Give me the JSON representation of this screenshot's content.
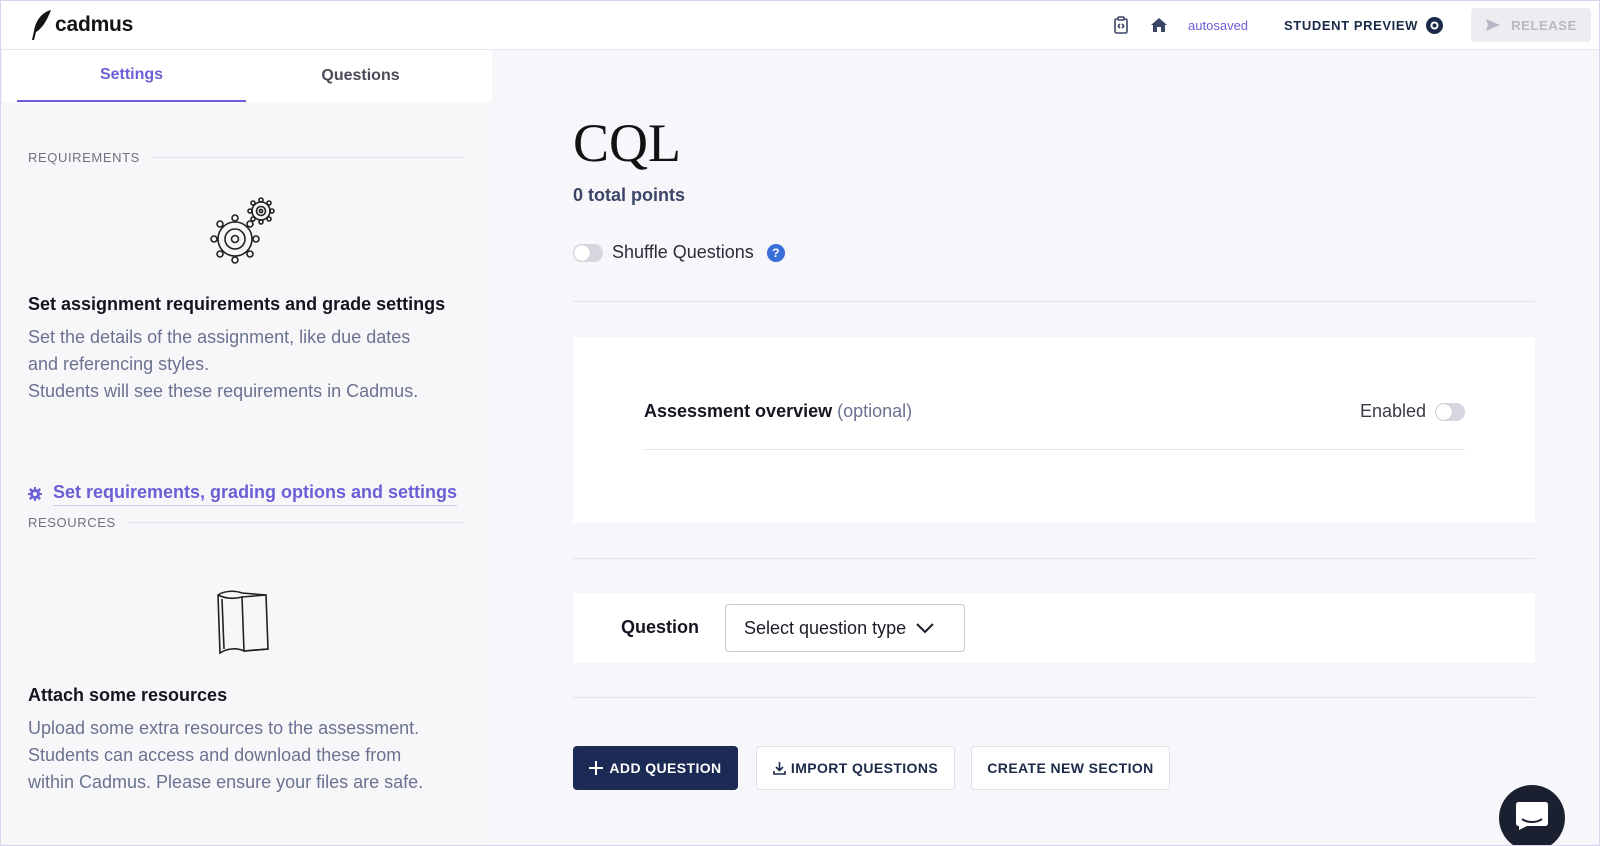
{
  "app": {
    "logo_text": "cadmus"
  },
  "topbar": {
    "autosaved": "autosaved",
    "student_preview": "STUDENT PREVIEW",
    "release": "RELEASE"
  },
  "sidebar": {
    "tabs": [
      {
        "label": "Settings",
        "active": true
      },
      {
        "label": "Questions",
        "active": false
      }
    ],
    "requirements": {
      "section_label": "REQUIREMENTS",
      "heading": "Set assignment requirements and grade settings",
      "desc_lines": [
        "Set the details of the assignment, like due dates",
        "and referencing styles.",
        "Students will see these requirements in Cadmus."
      ],
      "link": "Set requirements, grading options and settings"
    },
    "resources": {
      "section_label": "RESOURCES",
      "heading": "Attach some resources",
      "desc_lines": [
        "Upload some extra resources to the assessment.",
        "Students can access and download these from",
        "within Cadmus. Please ensure your files are safe."
      ]
    }
  },
  "main": {
    "title": "CQL",
    "points": "0 total points",
    "shuffle_label": "Shuffle Questions",
    "help_glyph": "?",
    "overview": {
      "title": "Assessment overview",
      "optional": "(optional)",
      "enabled_label": "Enabled"
    },
    "question": {
      "label": "Question",
      "select_placeholder": "Select question type"
    },
    "buttons": {
      "add": "ADD QUESTION",
      "import": "IMPORT QUESTIONS",
      "section": "CREATE NEW SECTION"
    }
  },
  "colors": {
    "accent": "#6b5fd6",
    "primary_button": "#1c2a56",
    "help_blue": "#3a6ed8"
  }
}
